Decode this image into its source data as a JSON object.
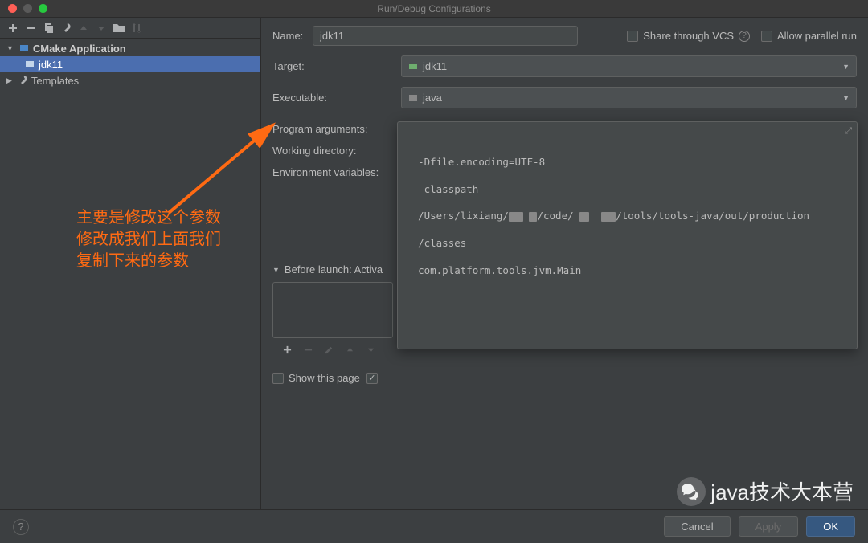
{
  "window": {
    "title": "Run/Debug Configurations"
  },
  "tree": {
    "group1": "CMake Application",
    "item1": "jdk11",
    "group2": "Templates"
  },
  "form": {
    "name_label": "Name:",
    "name_value": "jdk11",
    "share_label": "Share through VCS",
    "parallel_label": "Allow parallel run",
    "target_label": "Target:",
    "target_value": "jdk11",
    "exec_label": "Executable:",
    "exec_value": "java",
    "args_label": "Program arguments:",
    "wd_label": "Working directory:",
    "env_label": "Environment variables:"
  },
  "program_arguments": {
    "line1": "-Dfile.encoding=UTF-8",
    "line2": "-classpath",
    "line3a": "/Users/lixiang/",
    "line3b": "/code/",
    "line3c": "/tools/tools-java/out/production",
    "line4": "/classes",
    "line5": "com.platform.tools.jvm.Main"
  },
  "before_launch": {
    "header": "Before launch: Activa",
    "show_page": "Show this page"
  },
  "annotation": {
    "line1": "主要是修改这个参数",
    "line2": "修改成我们上面我们",
    "line3": "复制下来的参数"
  },
  "footer": {
    "cancel": "Cancel",
    "apply": "Apply",
    "ok": "OK"
  },
  "watermark": "java技术大本营"
}
